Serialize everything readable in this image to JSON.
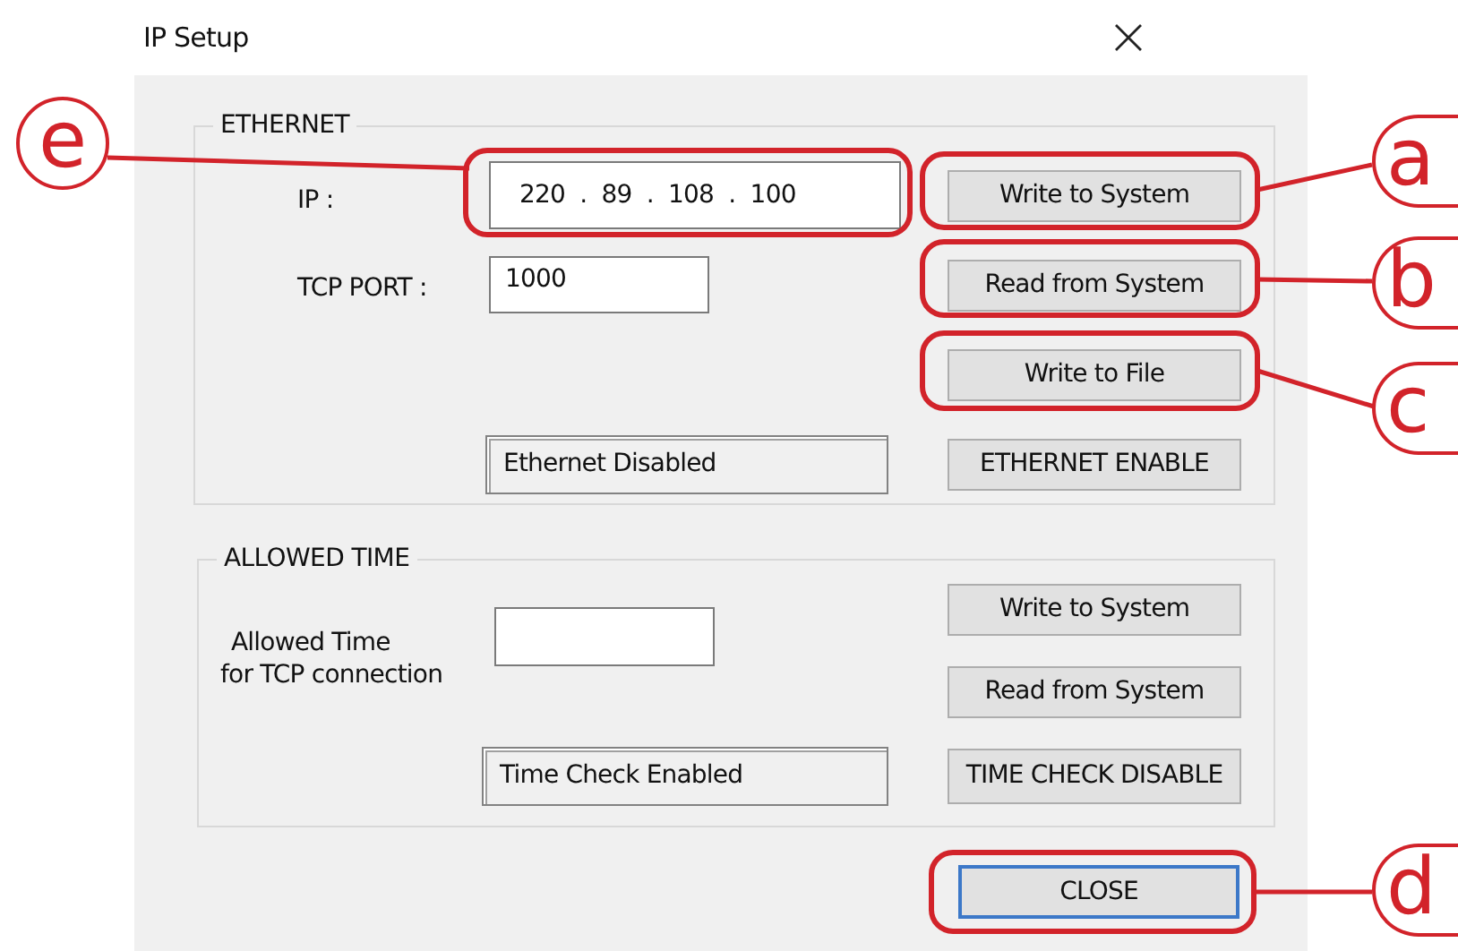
{
  "window": {
    "title": "IP Setup"
  },
  "ethernet": {
    "title": "ETHERNET",
    "ip_label": "IP :",
    "ip_value": "220  .  89  .  108  .  100",
    "port_label": "TCP PORT :",
    "port_value": "1000",
    "status": "Ethernet Disabled",
    "buttons": [
      "Write to System",
      "Read from System",
      "Write to File",
      "ETHERNET ENABLE"
    ]
  },
  "allowed_time": {
    "title": "ALLOWED TIME",
    "label_lines": [
      "Allowed Time",
      "for TCP connection"
    ],
    "status": "Time Check Enabled",
    "buttons": [
      "Write to System",
      "Read from System",
      "TIME CHECK DISABLE"
    ]
  },
  "close_button": {
    "label": "CLOSE",
    "default": true
  },
  "callouts": [
    {
      "letter": "e"
    },
    {
      "letter": "a"
    },
    {
      "letter": "b"
    },
    {
      "letter": "c"
    },
    {
      "letter": "d"
    }
  ]
}
